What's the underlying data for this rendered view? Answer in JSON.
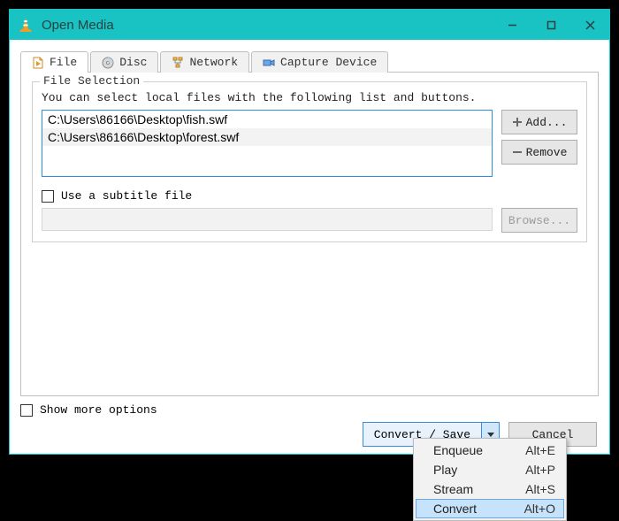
{
  "window": {
    "title": "Open Media"
  },
  "tabs": {
    "file": "File",
    "disc": "Disc",
    "network": "Network",
    "capture": "Capture Device"
  },
  "file_selection": {
    "legend": "File Selection",
    "hint": "You can select local files with the following list and buttons.",
    "files": [
      "C:\\Users\\86166\\Desktop\\fish.swf",
      "C:\\Users\\86166\\Desktop\\forest.swf"
    ],
    "add_label": "Add...",
    "remove_label": "Remove"
  },
  "subtitle": {
    "checkbox_label": "Use a subtitle file",
    "browse_label": "Browse..."
  },
  "show_more": "Show more options",
  "actions": {
    "convert_save": "Convert / Save",
    "cancel": "Cancel"
  },
  "dropdown": [
    {
      "label": "Enqueue",
      "shortcut": "Alt+E"
    },
    {
      "label": "Play",
      "shortcut": "Alt+P"
    },
    {
      "label": "Stream",
      "shortcut": "Alt+S"
    },
    {
      "label": "Convert",
      "shortcut": "Alt+O"
    }
  ]
}
